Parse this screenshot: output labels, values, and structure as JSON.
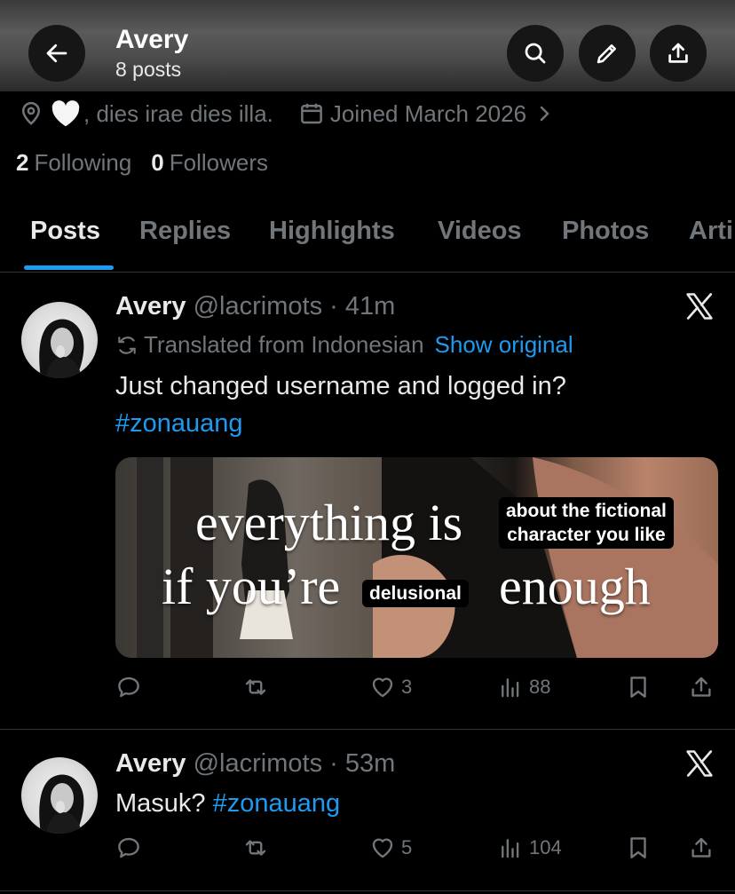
{
  "header": {
    "name": "Avery",
    "post_count": "8 posts",
    "icons": [
      "back-arrow-icon",
      "search-icon",
      "edit-icon",
      "share-icon"
    ]
  },
  "profile": {
    "location": ", dies irae dies illa.",
    "joined": "Joined March 2026",
    "following_count": "2",
    "following_label": "Following",
    "followers_count": "0",
    "followers_label": "Followers"
  },
  "tabs": [
    {
      "label": "Posts",
      "active": true
    },
    {
      "label": "Replies"
    },
    {
      "label": "Highlights"
    },
    {
      "label": "Videos"
    },
    {
      "label": "Photos"
    },
    {
      "label": "Arti"
    }
  ],
  "posts": [
    {
      "name": "Avery",
      "handle": "@lacrimots",
      "time": "41m",
      "translated_label": "Translated from Indonesian",
      "show_original": "Show original",
      "text": "Just changed username and logged in?",
      "hashtag": "#zonauang",
      "media": {
        "line1": "everything is",
        "line2_a": "if you’re",
        "line2_b": "enough",
        "label_top_1": "about the fictional",
        "label_top_2": "character you like",
        "label_mid": "delusional"
      },
      "likes": "3",
      "views": "88"
    },
    {
      "name": "Avery",
      "handle": "@lacrimots",
      "time": "53m",
      "text": "Masuk?",
      "hashtag": "#zonauang",
      "likes": "5",
      "views": "104"
    }
  ],
  "colors": {
    "accent": "#1d9bf0",
    "muted": "#71767b",
    "text": "#e7e9ea",
    "background": "#000000"
  }
}
